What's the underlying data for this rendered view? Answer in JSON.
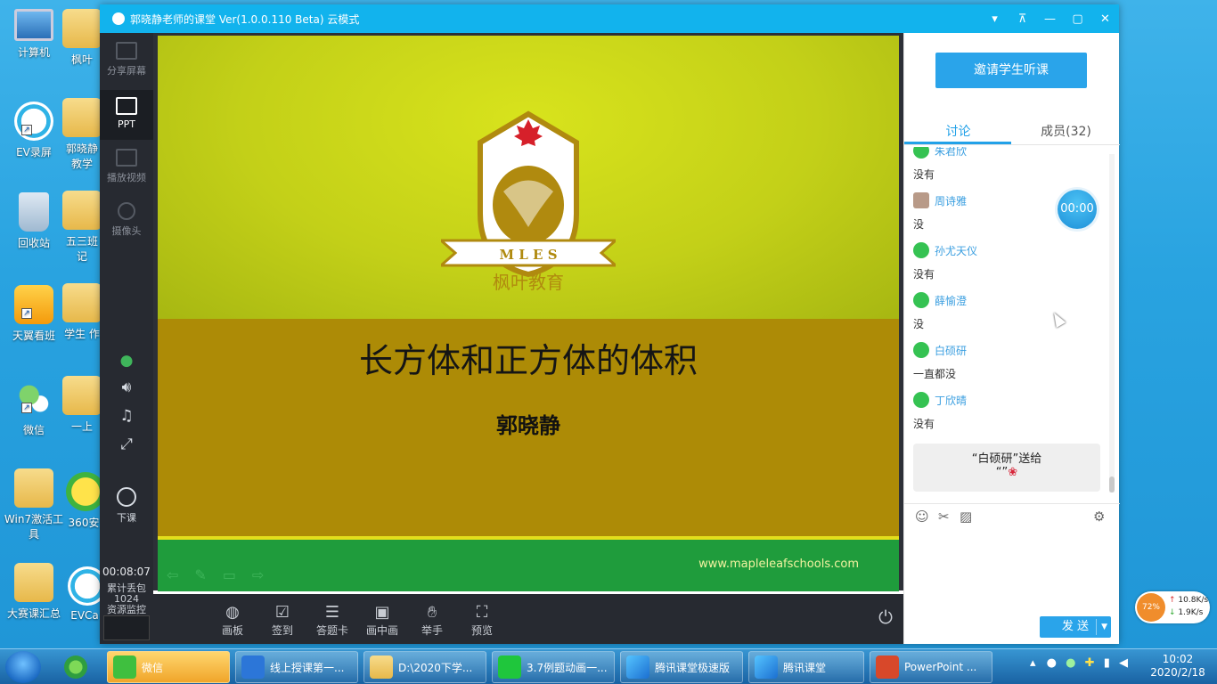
{
  "desktop": {
    "icons": [
      {
        "label": "计算机"
      },
      {
        "label": "枫叶"
      },
      {
        "label": "EV录屏"
      },
      {
        "label": "郭晓静教学"
      },
      {
        "label": "回收站"
      },
      {
        "label": "五三班 记"
      },
      {
        "label": "天翼看班"
      },
      {
        "label": "学生 作"
      },
      {
        "label": "微信"
      },
      {
        "label": "一上"
      },
      {
        "label": "Win7激活工具"
      },
      {
        "label": "360安"
      },
      {
        "label": "大赛课汇总"
      },
      {
        "label": "EVCa"
      }
    ]
  },
  "window": {
    "title": "郭晓静老师的课堂 Ver(1.0.0.110 Beta)  云模式",
    "controls": [
      "▾",
      "⊼",
      "—",
      "▢",
      "✕"
    ]
  },
  "left_sidebar": {
    "items": [
      {
        "label": "分享屏幕"
      },
      {
        "label": "PPT"
      },
      {
        "label": "播放视频"
      },
      {
        "label": "摄像头"
      }
    ],
    "end_class_label": "下课",
    "elapsed": "00:08:07",
    "cumulative_label": "累计丢包",
    "cumulative_value": "1024",
    "resource_monitor": "资源监控"
  },
  "slide": {
    "logo_text": "M L E S",
    "brand": "枫叶教育",
    "title": "长方体和正方体的体积",
    "author": "郭晓静",
    "url": "www.mapleleafschools.com"
  },
  "bottom_toolbar": {
    "items": [
      {
        "label": "画板",
        "icon": "palette-icon"
      },
      {
        "label": "签到",
        "icon": "checkin-icon"
      },
      {
        "label": "答题卡",
        "icon": "answer-card-icon"
      },
      {
        "label": "画中画",
        "icon": "pip-icon"
      },
      {
        "label": "举手",
        "icon": "hand-icon"
      },
      {
        "label": "预览",
        "icon": "preview-icon"
      }
    ]
  },
  "right_panel": {
    "invite_button": "邀请学生听课",
    "tabs": [
      "讨论",
      "成员(32)"
    ],
    "messages": [
      {
        "name": "朱君欣",
        "text": "没有"
      },
      {
        "name": "周诗雅",
        "text": "没"
      },
      {
        "name": "孙尤天仪",
        "text": "没有"
      },
      {
        "name": "薛愉澄",
        "text": "没"
      },
      {
        "name": "白硕研",
        "text": "一直都没"
      },
      {
        "name": "丁欣晴",
        "text": "没有"
      }
    ],
    "gift_text": "“白硕研”送给",
    "gift_sub": "“”",
    "timer": "00:00",
    "send_label": "发 送"
  },
  "network": {
    "percent": "72%",
    "up": "10.8K/s",
    "down": "1.9K/s"
  },
  "taskbar": {
    "buttons": [
      {
        "label": "微信"
      },
      {
        "label": "线上授课第一..."
      },
      {
        "label": "D:\\2020下学..."
      },
      {
        "label": "3.7例题动画一..."
      },
      {
        "label": "腾讯课堂极速版"
      },
      {
        "label": "腾讯课堂"
      },
      {
        "label": "PowerPoint ..."
      }
    ],
    "time": "10:02",
    "date": "2020/2/18"
  }
}
